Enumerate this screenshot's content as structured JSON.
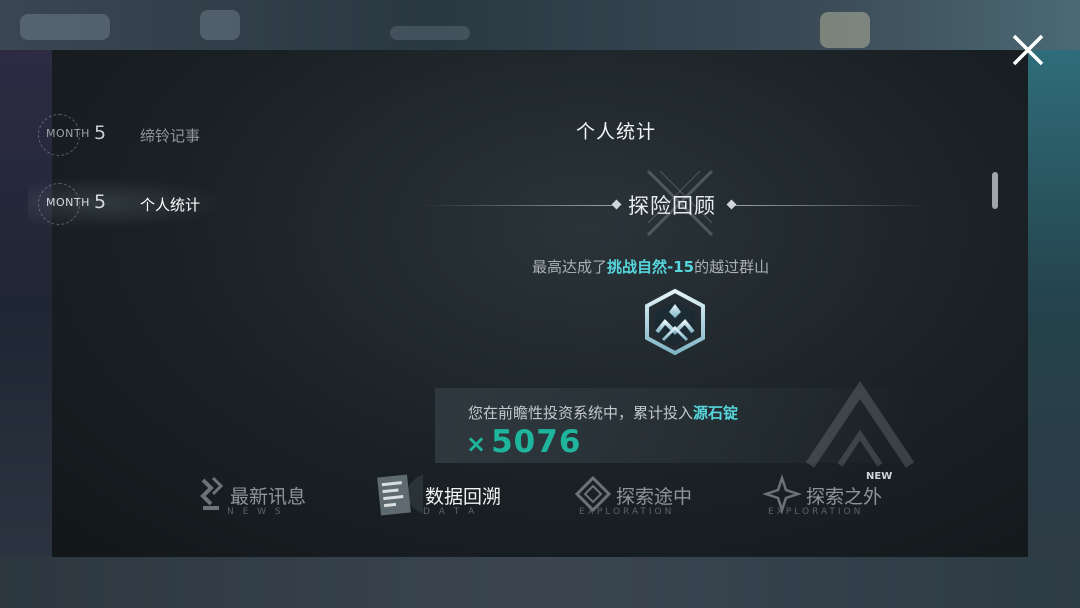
{
  "nav": {
    "items": [
      {
        "month_word": "MONTH",
        "month_num": "5",
        "label": "缔铃记事"
      },
      {
        "month_word": "MONTH",
        "month_num": "5",
        "label": "个人统计"
      }
    ]
  },
  "content": {
    "title": "个人统计",
    "section_title": "探险回顾",
    "achievement": {
      "prefix": "最高达成了",
      "highlight": "挑战自然-15",
      "suffix": "的越过群山"
    },
    "investment": {
      "prefix": "您在前瞻性投资系统中，累计投入",
      "highlight": "源石锭",
      "multiplier": "×",
      "amount": "5076"
    }
  },
  "tabs": [
    {
      "label": "最新讯息",
      "sub": "N E W S",
      "active": false
    },
    {
      "label": "数据回溯",
      "sub": "D A T A",
      "active": true
    },
    {
      "label": "探索途中",
      "sub": "EXPLORATION",
      "active": false
    },
    {
      "label": "探索之外",
      "sub": "EXPLORATION",
      "new_badge": "NEW",
      "active": false
    }
  ],
  "colors": {
    "accent_cyan": "#57d6dd",
    "amount_teal": "#1fb59c"
  },
  "icons": {
    "close": "close-icon",
    "badge": "mountain-crest-icon"
  }
}
